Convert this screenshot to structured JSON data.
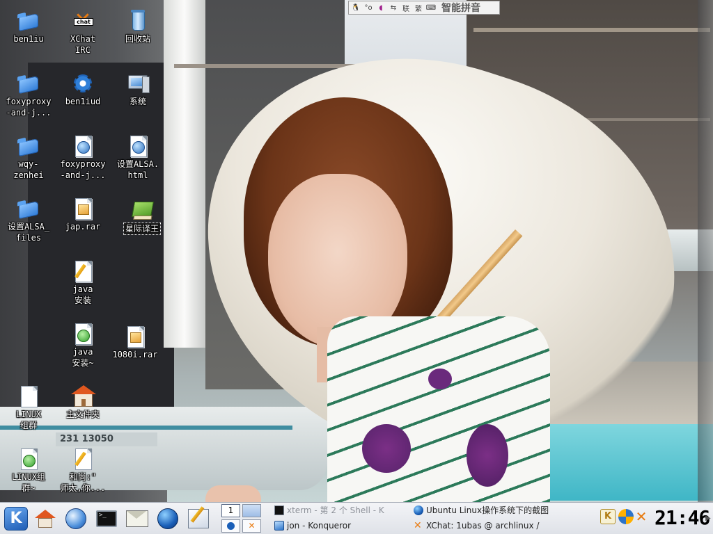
{
  "ime_bar": {
    "buttons": [
      "tux-icon",
      "chinese-punct-icon",
      "moon-icon",
      "switch-icon",
      "lian",
      "fan",
      "keyboard-icon"
    ],
    "lian_label": "联",
    "fan_label": "繁",
    "name": "智能拼音"
  },
  "desktop_icons": [
    {
      "label": "ben1iu",
      "icon": "folder-icon"
    },
    {
      "label": "foxyproxy\n-and-j...",
      "icon": "folder-icon"
    },
    {
      "label": "wqy-\nzenhei",
      "icon": "folder-icon"
    },
    {
      "label": "设置ALSA_\nfiles",
      "icon": "folder-icon"
    },
    {
      "label": "LINUX\n组群",
      "icon": "document-icon"
    },
    {
      "label": "LINUX组\n群~",
      "icon": "document-icon"
    },
    {
      "label": "XChat\nIRC",
      "icon": "xchat-icon"
    },
    {
      "label": "ben1iud",
      "icon": "gear-icon"
    },
    {
      "label": "foxyproxy\n-and-j...",
      "icon": "html-document-icon"
    },
    {
      "label": "jap.rar",
      "icon": "archive-icon"
    },
    {
      "label": "java\n安装",
      "icon": "text-document-icon"
    },
    {
      "label": "java\n安装~",
      "icon": "text-document-icon"
    },
    {
      "label": "主文件夹",
      "icon": "home-folder-icon"
    },
    {
      "label": "和尚:\"\n师太,你...",
      "icon": "text-document-icon"
    },
    {
      "label": "回收站",
      "icon": "trash-icon"
    },
    {
      "label": "系统",
      "icon": "computer-icon"
    },
    {
      "label": "设置ALSA.\nhtml",
      "icon": "html-document-icon"
    },
    {
      "label": "星际译王",
      "icon": "dictionary-icon"
    },
    {
      "label": "1080i.rar",
      "icon": "archive-icon"
    }
  ],
  "wallpaper": {
    "boat_number": "231 13050"
  },
  "panel": {
    "launchers": [
      "kde-menu-icon",
      "home-icon",
      "system-ball-icon",
      "terminal-icon",
      "mail-icon",
      "browser-globe-icon",
      "text-editor-icon"
    ],
    "pager": {
      "desktop_1": "1"
    },
    "tasks": [
      {
        "label": "xterm - 第 2 个 Shell - K",
        "icon": "terminal-icon",
        "dim": true
      },
      {
        "label": "Ubuntu Linux操作系统下的截图",
        "icon": "globe-icon",
        "dim": false
      },
      {
        "label": "jon - Konqueror",
        "icon": "konqueror-icon",
        "dim": false
      },
      {
        "label": "XChat: 1ubas @ archlinux /",
        "icon": "xchat-icon",
        "dim": false
      }
    ],
    "tray": [
      "klipper-icon",
      "swirl-icon",
      "xchat-tray-icon"
    ],
    "clock": "21:46",
    "handle": "▶"
  }
}
